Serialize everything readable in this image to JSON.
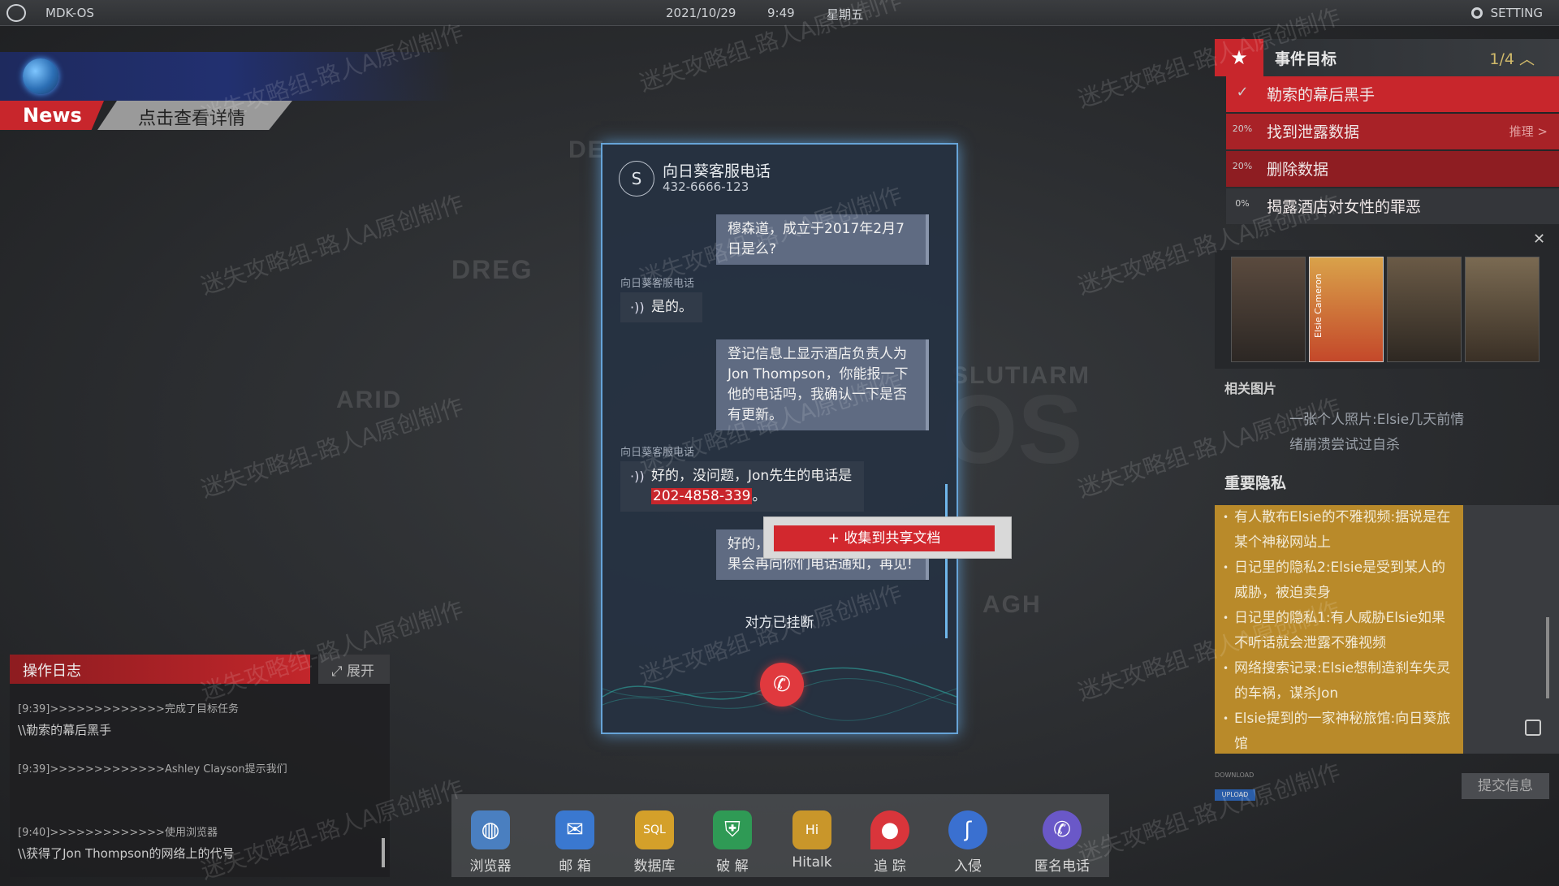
{
  "topbar": {
    "os_name": "MDK-OS",
    "date": "2021/10/29",
    "time": "9:49",
    "weekday": "星期五",
    "setting_label": "SETTING"
  },
  "news": {
    "tag": "News",
    "detail": "点击查看详情"
  },
  "map": {
    "labels": [
      "DE",
      "DREG",
      "ARID",
      "SLUTIARM",
      "AGH"
    ],
    "logo": "OS"
  },
  "log": {
    "title": "操作日志",
    "expand_label": "展开",
    "entries": [
      {
        "time_line": "[9:39]>>>>>>>>>>>>>完成了目标任务",
        "detail": "\\\\勒索的幕后黑手"
      },
      {
        "time_line": "[9:39]>>>>>>>>>>>>>Ashley Clayson提示我们",
        "detail": ""
      },
      {
        "time_line": "[9:40]>>>>>>>>>>>>>使用浏览器",
        "detail": "\\\\获得了Jon Thompson的网络上的代号"
      }
    ]
  },
  "call": {
    "avatar_letter": "S",
    "caller_name": "向日葵客服电话",
    "caller_number": "432-6666-123",
    "messages": {
      "out1": "穆森道，成立于2017年2月7日是么?",
      "sender1": "向日葵客服电话",
      "in1": "是的。",
      "out2": "登记信息上显示酒店负责人为Jon Thompson，你能报一下他的电话吗，我确认一下是否有更新。",
      "sender2": "向日葵客服电话",
      "in2_prefix": "好的，没问题，Jon先生的电话是",
      "in2_phone": "202-4858-339",
      "in2_suffix": "。",
      "out3": "好的，谢谢。我们调查处理结果会再向你们电话通知，再见!"
    },
    "hangup_note": "对方已挂断",
    "hangup_icon": "phone-hangup-icon"
  },
  "context_menu": {
    "collect_label": "+ 收集到共享文档"
  },
  "goals": {
    "title": "事件目标",
    "count": "1/4",
    "items": [
      {
        "pct": "",
        "label": "勒索的幕后黑手",
        "done": true,
        "extra": ""
      },
      {
        "pct": "20%",
        "label": "找到泄露数据",
        "done": false,
        "extra": "推理 >"
      },
      {
        "pct": "20%",
        "label": "删除数据",
        "done": false,
        "extra": ""
      },
      {
        "pct": "0%",
        "label": "揭露酒店对女性的罪恶",
        "done": false,
        "extra": ""
      }
    ]
  },
  "related": {
    "title": "相关图片",
    "photo_caption": "Elsie Cameron",
    "text": "一张个人照片:Elsie几天前情绪崩溃尝试过自杀"
  },
  "privacy": {
    "title": "重要隐私",
    "items": [
      "有人散布Elsie的不雅视频:据说是在某个神秘网站上",
      "日记里的隐私2:Elsie是受到某人的威胁，被迫卖身",
      "日记里的隐私1:有人威胁Elsie如果不听话就会泄露不雅视频",
      "网络搜索记录:Elsie想制造刹车失灵的车祸，谋杀Jon",
      "Elsie提到的一家神秘旅馆:向日葵旅馆"
    ],
    "submit_label": "提交信息",
    "download_label": "DOWNLOAD",
    "upload_label": "UPLOAD"
  },
  "dock": [
    {
      "label": "浏览器",
      "icon": "globe-icon",
      "color": "#4a7fc0"
    },
    {
      "label": "邮 箱",
      "icon": "mail-icon",
      "color": "#3a78d0"
    },
    {
      "label": "数据库",
      "icon": "database-icon",
      "color": "#d4a02a"
    },
    {
      "label": "破 解",
      "icon": "shield-icon",
      "color": "#2f9a55"
    },
    {
      "label": "Hitalk",
      "icon": "chat-icon",
      "color": "#c9962a"
    },
    {
      "label": "追 踪",
      "icon": "location-pin-icon",
      "color": "#d9353b"
    },
    {
      "label": "入侵",
      "icon": "hook-icon",
      "color": "#3a70d0"
    },
    {
      "label": "匿名电话",
      "icon": "phone-icon",
      "color": "#6a58c8"
    }
  ],
  "watermark": "迷失攻略组-路人A原创制作",
  "colors": {
    "accent_red": "#c8262c",
    "glow_blue": "#67a4d8",
    "privacy_gold": "#b98a2a"
  }
}
